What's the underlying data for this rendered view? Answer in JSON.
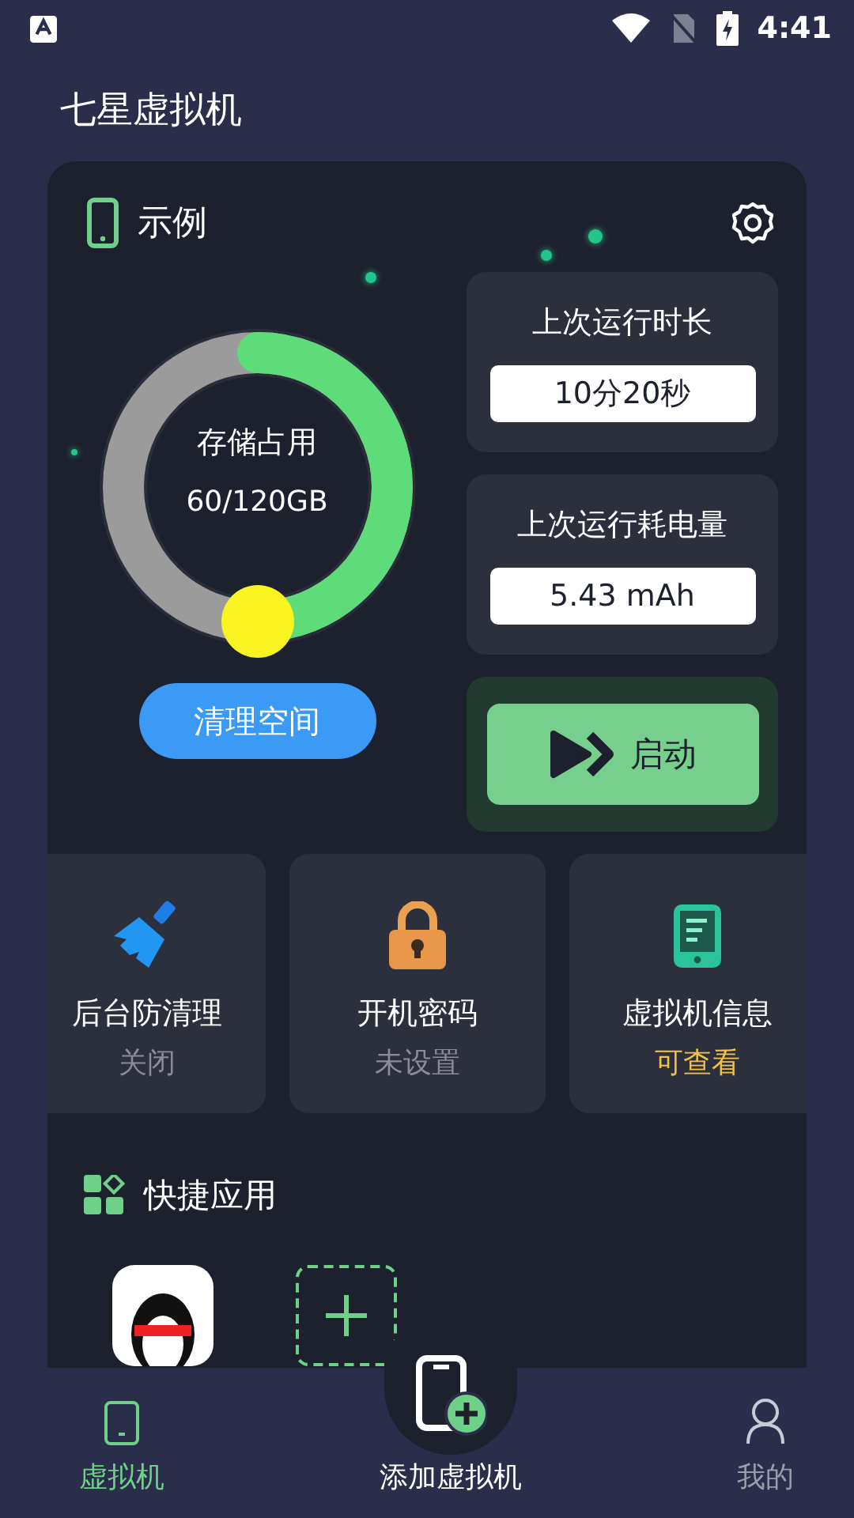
{
  "status_bar": {
    "time": "4:41"
  },
  "app_title": "七星虚拟机",
  "vm_card": {
    "title": "示例",
    "storage": {
      "label": "存储占用",
      "reading": "60/120GB",
      "level": 0.5
    },
    "clean_button": "清理空间",
    "stats": [
      {
        "label": "上次运行时长",
        "value": "10分20秒"
      },
      {
        "label": "上次运行耗电量",
        "value": "5.43 mAh"
      }
    ],
    "start_button": "启动"
  },
  "features": [
    {
      "kind": "broom",
      "title": "后台防清理",
      "status": "关闭",
      "color": "#8a8d98"
    },
    {
      "kind": "lock",
      "title": "开机密码",
      "status": "未设置",
      "color": "#8a8d98"
    },
    {
      "kind": "phone",
      "title": "虚拟机信息",
      "status": "可查看",
      "color": "#f2c04a"
    }
  ],
  "quick_apps": {
    "title": "快捷应用",
    "items": [
      {
        "kind": "app"
      },
      {
        "kind": "add"
      }
    ]
  },
  "nav": [
    {
      "kind": "vm",
      "label": "虚拟机",
      "selected": true
    },
    {
      "kind": "add",
      "label": "添加虚拟机",
      "selected": false
    },
    {
      "kind": "me",
      "label": "我的",
      "selected": false
    }
  ]
}
